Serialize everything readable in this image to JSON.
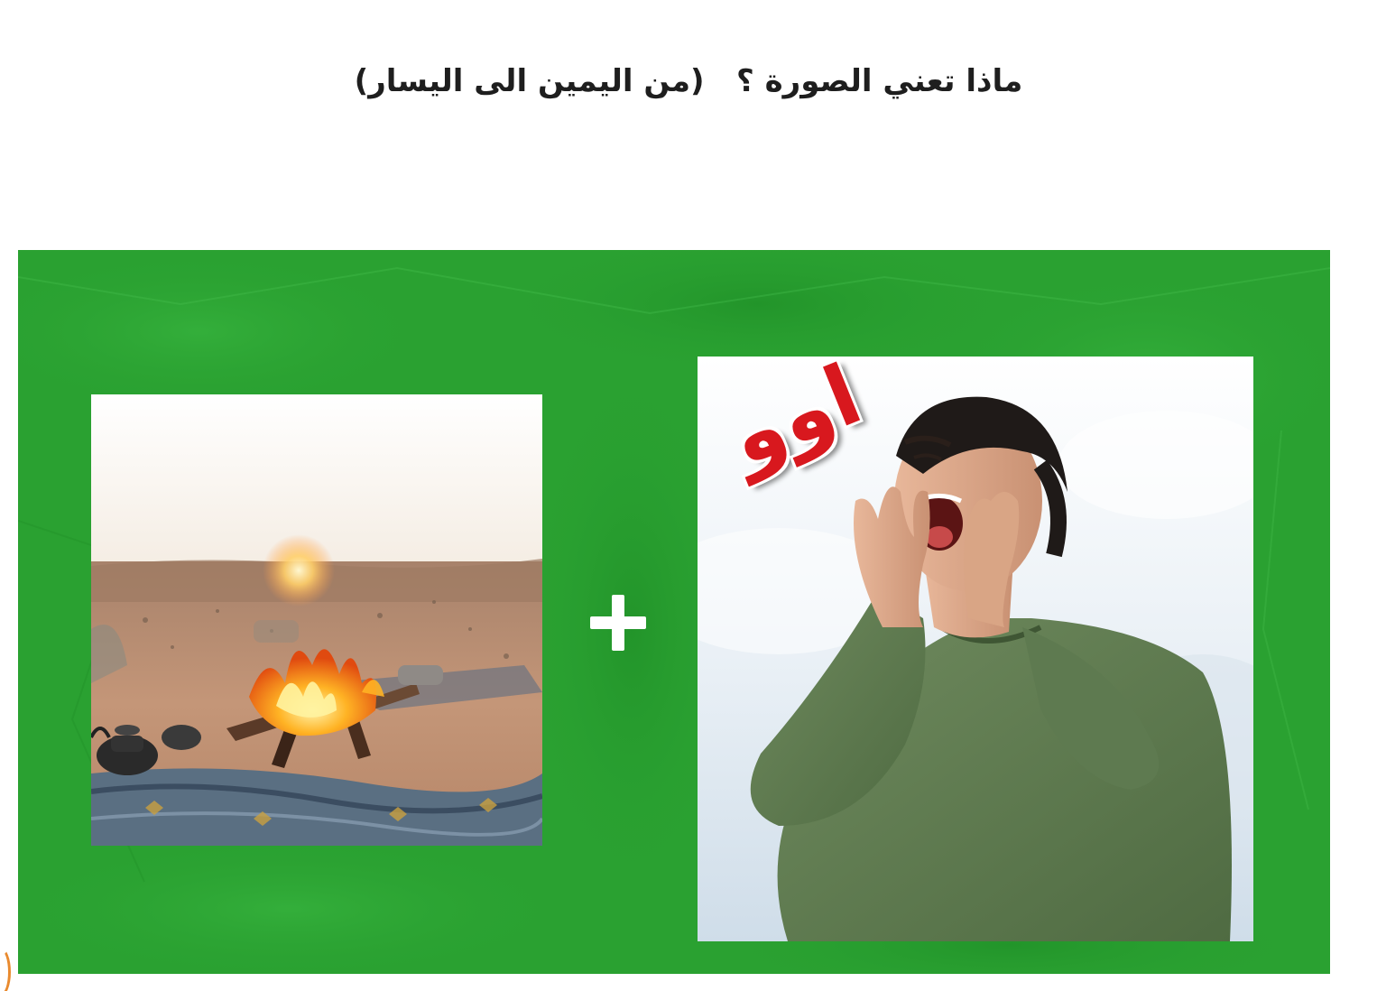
{
  "question": {
    "text": "ماذا تعني الصورة ؟   (من اليمين الى اليسار)"
  },
  "puzzle": {
    "background_color": "#2aa131",
    "right_picture": {
      "subject": "man-shouting-with-hands-around-mouth",
      "caption": "اوو",
      "caption_color": "#d8181e"
    },
    "operator": "+",
    "left_picture": {
      "subject": "campfire-in-desert-at-sunset"
    }
  }
}
